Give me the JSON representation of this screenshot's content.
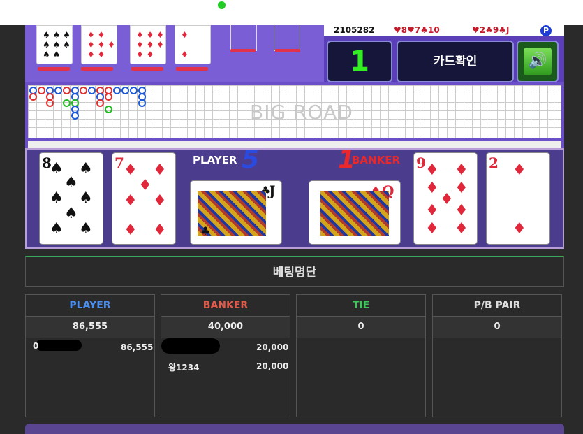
{
  "round": {
    "id": "2105282",
    "player_hand": "♥8♥7♣10",
    "banker_hand": "♥2♣9♣J",
    "p_badge": "P"
  },
  "controls": {
    "counter": "1",
    "confirm_label": "카드확인",
    "sound_icon": "🔊"
  },
  "bigroad": {
    "label": "BIG ROAD"
  },
  "player": {
    "label": "PLAYER",
    "score": "5"
  },
  "banker": {
    "label": "BANKER",
    "score": "1"
  },
  "cards": {
    "player_1": "8",
    "player_2": "7",
    "player_3": "J",
    "banker_1": "Q",
    "banker_2": "9",
    "banker_3": "2"
  },
  "betting": {
    "title": "베팅명단",
    "columns": [
      {
        "label": "PLAYER",
        "color": "#4a8ef0",
        "total": "86,555"
      },
      {
        "label": "BANKER",
        "color": "#e05a4a",
        "total": "40,000"
      },
      {
        "label": "TIE",
        "color": "#3ec85a",
        "total": "0"
      },
      {
        "label": "P/B PAIR",
        "color": "#dddddd",
        "total": "0"
      }
    ],
    "player_entries": [
      {
        "name": "0",
        "amount": "86,555"
      }
    ],
    "banker_entries": [
      {
        "name": "",
        "amount": "20,000"
      },
      {
        "name": "왕1234",
        "amount": "20,000"
      }
    ]
  }
}
